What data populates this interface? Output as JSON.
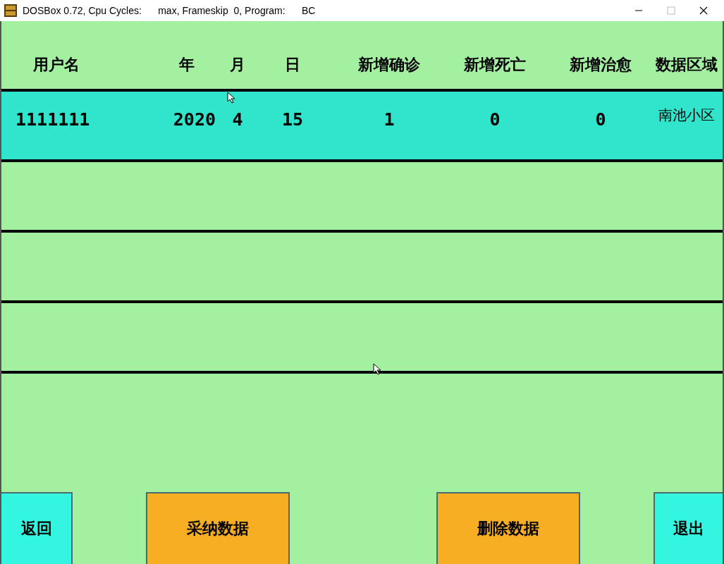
{
  "window": {
    "title": "DOSBox 0.72, Cpu Cycles:      max, Frameskip  0, Program:      BC"
  },
  "table": {
    "columns": [
      "用户名",
      "年",
      "月",
      "日",
      "新增确诊",
      "新增死亡",
      "新增治愈",
      "数据区域"
    ],
    "rows": [
      {
        "selected": true,
        "cells": [
          "1111111",
          "2020",
          "4",
          "15",
          "1",
          "0",
          "0",
          "南池小区"
        ]
      },
      {
        "selected": false
      },
      {
        "selected": false
      },
      {
        "selected": false
      }
    ]
  },
  "buttons": [
    {
      "label": "返回",
      "color": "#33f5e0"
    },
    {
      "label": "采纳数据",
      "color": "#f7ae22"
    },
    {
      "label": "删除数据",
      "color": "#f7ae22"
    },
    {
      "label": "退出",
      "color": "#33f5e0"
    }
  ]
}
